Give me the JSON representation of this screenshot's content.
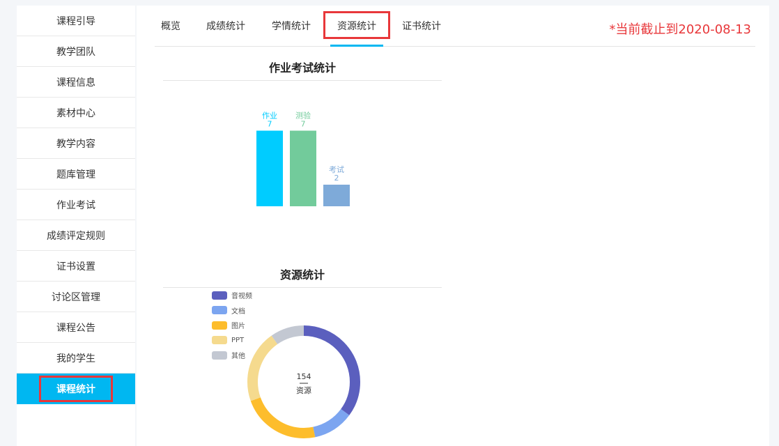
{
  "sidebar": {
    "items": [
      {
        "label": "课程引导"
      },
      {
        "label": "教学团队"
      },
      {
        "label": "课程信息"
      },
      {
        "label": "素材中心"
      },
      {
        "label": "教学内容"
      },
      {
        "label": "题库管理"
      },
      {
        "label": "作业考试"
      },
      {
        "label": "成绩评定规则"
      },
      {
        "label": "证书设置"
      },
      {
        "label": "讨论区管理"
      },
      {
        "label": "课程公告"
      },
      {
        "label": "我的学生"
      },
      {
        "label": "课程统计"
      }
    ],
    "active_label": "课程统计"
  },
  "tabs": {
    "items": [
      {
        "label": "概览"
      },
      {
        "label": "成绩统计"
      },
      {
        "label": "学情统计"
      },
      {
        "label": "资源统计"
      },
      {
        "label": "证书统计"
      }
    ],
    "active": "资源统计"
  },
  "cutoff_text": "*当前截止到2020-08-13",
  "colors": {
    "accent": "#00b7f1",
    "highlight": "#e8373a"
  },
  "chart_data": [
    {
      "type": "bar",
      "title": "作业考试统计",
      "categories": [
        "作业",
        "测验",
        "考试"
      ],
      "values": [
        7,
        7,
        2
      ],
      "colors": [
        "#00ccff",
        "#72cb9b",
        "#7eaad9"
      ]
    },
    {
      "type": "pie",
      "title": "资源统计",
      "center_value": "154",
      "center_label": "资源",
      "labels": [
        "音视频",
        "文档",
        "图片",
        "PPT",
        "其他"
      ],
      "values": [
        54,
        18,
        35,
        32,
        15
      ],
      "colors": [
        "#5b5fbe",
        "#7ca5f0",
        "#fdbd2c",
        "#f5da8e",
        "#c3c8d2"
      ]
    }
  ]
}
